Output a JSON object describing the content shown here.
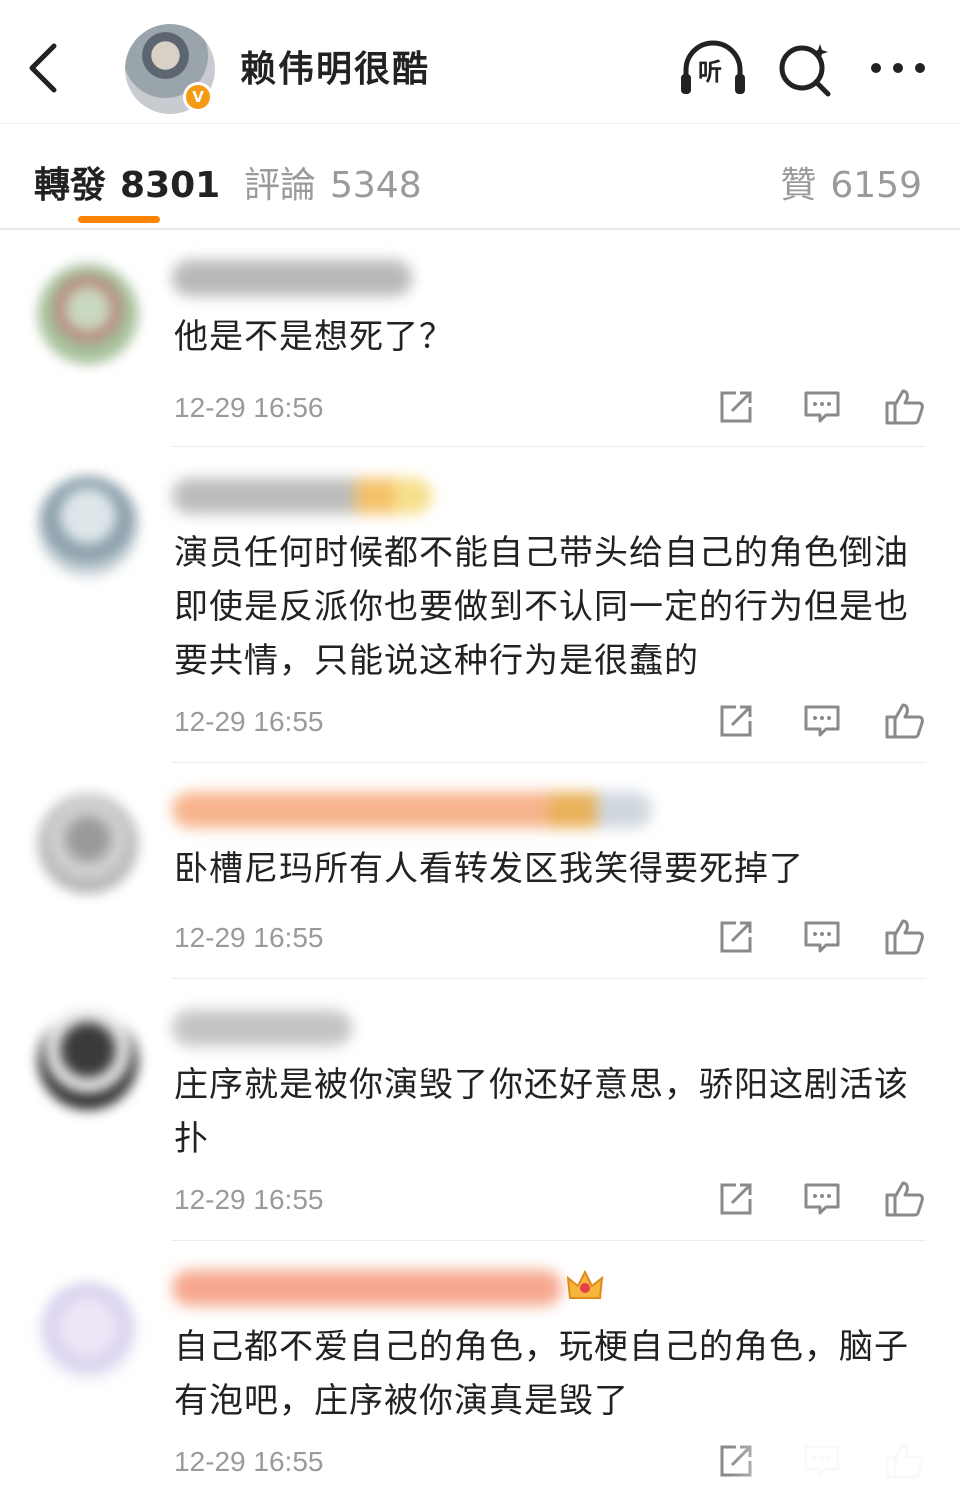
{
  "header": {
    "title": "赖伟明很酷",
    "verified_badge": "V",
    "listen_label": "听",
    "icons": {
      "back": "chevron-left-icon",
      "listen": "headphones-icon",
      "search": "search-sparkle-icon",
      "more": "more-dots-icon"
    }
  },
  "tabs": [
    {
      "label": "轉發",
      "count": "8301",
      "active": true
    },
    {
      "label": "評論",
      "count": "5348",
      "active": false
    },
    {
      "label": "贊",
      "count": "6159",
      "active": false
    }
  ],
  "accent_color": "#ff8200",
  "comments": [
    {
      "text": "他是不是想死了？",
      "time": "12-29 16:56"
    },
    {
      "text": "演员任何时候都不能自己带头给自己的角色倒油即使是反派你也要做到不认同一定的行为但是也要共情，只能说这种行为是很蠢的",
      "time": "12-29 16:55"
    },
    {
      "text": "卧槽尼玛所有人看转发区我笑得要死掉了",
      "time": "12-29 16:55"
    },
    {
      "text": "庄序就是被你演毁了你还好意思，骄阳这剧活该扑",
      "time": "12-29 16:55"
    },
    {
      "text": "自己都不爱自己的角色，玩梗自己的角色，脑子有泡吧，庄序被你演真是毁了",
      "time": "12-29 16:55"
    }
  ]
}
